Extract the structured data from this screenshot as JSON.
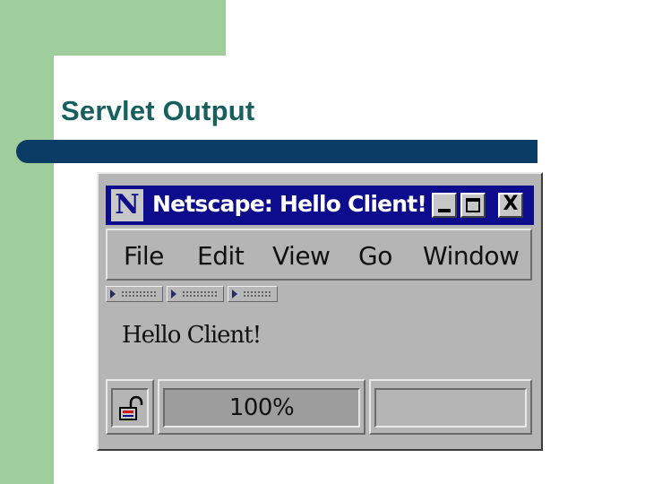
{
  "slide": {
    "title": "Servlet Output"
  },
  "window": {
    "title": "Netscape: Hello Client!",
    "logo_letter": "N",
    "close_glyph": "X",
    "menu": [
      "File",
      "Edit",
      "View",
      "Go",
      "Window"
    ],
    "content_text": "Hello Client!",
    "status": {
      "progress_label": "100%",
      "progress_value": 1.0,
      "message": ""
    }
  },
  "icons": [
    "netscape-logo-icon",
    "minimize-icon",
    "maximize-icon",
    "close-icon",
    "toolbar-expand-icon",
    "security-lock-icon"
  ],
  "colors": {
    "slide_green": "#a0cd9c",
    "title_text": "#17605f",
    "title_rule": "#0b3c66",
    "caption_bar": "#0c0c8c",
    "window_gray": "#b5b5b5"
  }
}
